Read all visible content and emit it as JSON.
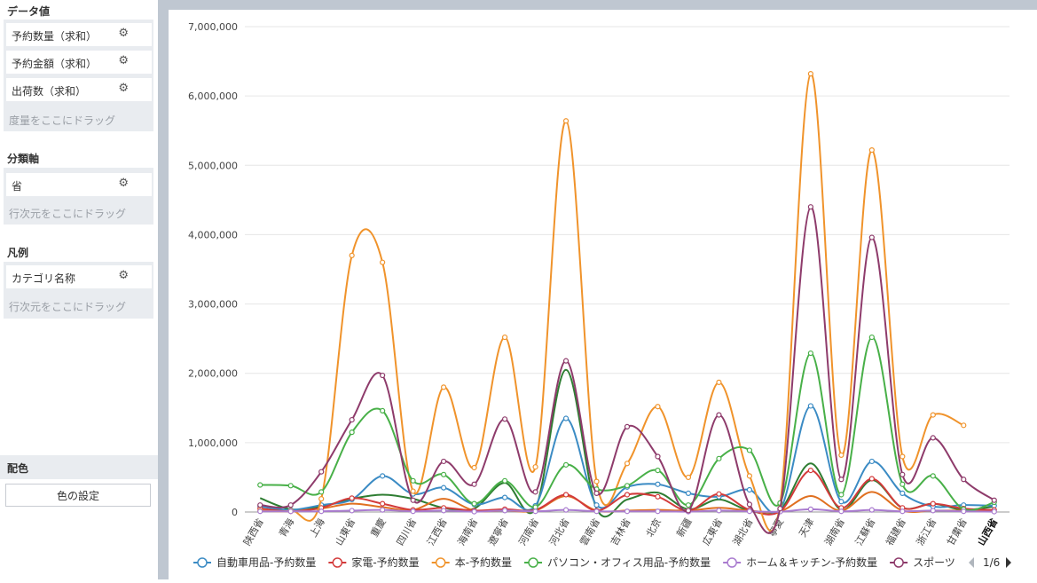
{
  "panel": {
    "data_values": {
      "title": "データ値",
      "items": [
        "予約数量（求和）",
        "予約金額（求和）",
        "出荷数（求和）"
      ],
      "hint": "度量をここにドラッグ"
    },
    "category_axis": {
      "title": "分類軸",
      "items": [
        "省"
      ],
      "hint": "行次元をここにドラッグ"
    },
    "legend": {
      "title": "凡例",
      "items": [
        "カテゴリ名称"
      ],
      "hint": "行次元をここにドラッグ"
    },
    "color": {
      "title": "配色",
      "button_label": "色の設定"
    },
    "gear_icon": "⚙"
  },
  "chart_data": {
    "type": "line",
    "categories": [
      "陕西省",
      "青海",
      "上海",
      "山東省",
      "重慶",
      "四川省",
      "江西省",
      "海南省",
      "遼寧省",
      "河南省",
      "河北省",
      "雲南省",
      "吉林省",
      "北京",
      "新疆",
      "広東省",
      "湖北省",
      "寧夏",
      "天津",
      "湖南省",
      "江蘇省",
      "福建省",
      "浙江省",
      "甘粛省",
      "山西省"
    ],
    "ylim": [
      0,
      7000000
    ],
    "yticks": [
      0,
      1000000,
      2000000,
      3000000,
      4000000,
      5000000,
      6000000,
      7000000
    ],
    "ytick_labels": [
      "0",
      "1,000,000",
      "2,000,000",
      "3,000,000",
      "4,000,000",
      "5,000,000",
      "6,000,000",
      "7,000,000"
    ],
    "grid": true,
    "legend_position": "bottom",
    "series": [
      {
        "name": "自動車用品-予約数量",
        "color": "#3b8bc4",
        "values": [
          80000,
          30000,
          100000,
          180000,
          520000,
          260000,
          350000,
          110000,
          210000,
          90000,
          1350000,
          100000,
          360000,
          400000,
          270000,
          220000,
          320000,
          30000,
          1530000,
          150000,
          730000,
          270000,
          80000,
          100000,
          90000
        ]
      },
      {
        "name": "家電-予約数量",
        "color": "#d33b3b",
        "values": [
          50000,
          10000,
          60000,
          200000,
          120000,
          30000,
          60000,
          20000,
          40000,
          30000,
          250000,
          20000,
          250000,
          220000,
          20000,
          260000,
          30000,
          10000,
          600000,
          60000,
          480000,
          60000,
          120000,
          50000,
          30000
        ]
      },
      {
        "name": "本-予約数量",
        "color": "#f0932b",
        "values": [
          20000,
          20000,
          190000,
          3700000,
          3600000,
          300000,
          1800000,
          640000,
          2520000,
          650000,
          5640000,
          440000,
          700000,
          1520000,
          500000,
          1870000,
          520000,
          120000,
          6320000,
          820000,
          5220000,
          800000,
          1400000,
          1250000,
          null
        ]
      },
      {
        "name": "パソコン・オフィス用品-予約数量",
        "color": "#48b048",
        "values": [
          390000,
          380000,
          290000,
          1150000,
          1460000,
          450000,
          540000,
          120000,
          450000,
          70000,
          680000,
          330000,
          380000,
          600000,
          100000,
          770000,
          890000,
          130000,
          2290000,
          250000,
          2520000,
          400000,
          520000,
          40000,
          140000
        ]
      },
      {
        "name": "ホーム＆キッチン-予約数量",
        "color": "#a97bcf",
        "values": [
          10000,
          10000,
          10000,
          20000,
          30000,
          10000,
          20000,
          5000,
          20000,
          10000,
          30000,
          10000,
          10000,
          10000,
          5000,
          20000,
          10000,
          5000,
          40000,
          10000,
          30000,
          10000,
          20000,
          10000,
          5000
        ]
      },
      {
        "name": "スポーツ",
        "color": "#8e3b6b",
        "values": [
          100000,
          100000,
          580000,
          1330000,
          1970000,
          170000,
          730000,
          400000,
          1340000,
          290000,
          2180000,
          270000,
          1230000,
          800000,
          20000,
          1400000,
          110000,
          50000,
          4400000,
          470000,
          3960000,
          540000,
          1070000,
          470000,
          170000
        ]
      }
    ],
    "extra_lines": [
      {
        "color": "#2e7d32",
        "values": [
          200000,
          40000,
          80000,
          190000,
          250000,
          190000,
          60000,
          50000,
          420000,
          50000,
          2050000,
          50000,
          180000,
          280000,
          40000,
          180000,
          20000,
          30000,
          700000,
          30000,
          460000,
          60000,
          120000,
          30000,
          80000
        ]
      },
      {
        "color": "#e07020",
        "values": [
          30000,
          20000,
          50000,
          120000,
          70000,
          30000,
          190000,
          20000,
          20000,
          20000,
          230000,
          20000,
          20000,
          30000,
          20000,
          60000,
          20000,
          10000,
          230000,
          20000,
          290000,
          20000,
          20000,
          20000,
          20000
        ]
      }
    ],
    "legend_page": "1/6"
  }
}
